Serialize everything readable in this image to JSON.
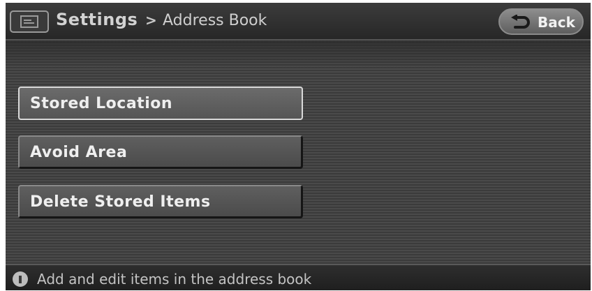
{
  "header": {
    "title": "Settings",
    "separator": ">",
    "subtitle": "Address Book",
    "icon": "screen-icon",
    "back_label": "Back",
    "back_icon": "return-arrow-icon"
  },
  "menu": {
    "items": [
      {
        "label": "Stored Location",
        "selected": true
      },
      {
        "label": "Avoid Area",
        "selected": false
      },
      {
        "label": "Delete Stored Items",
        "selected": false
      }
    ]
  },
  "status": {
    "icon": "info-icon",
    "text": "Add and edit items in the address book"
  }
}
